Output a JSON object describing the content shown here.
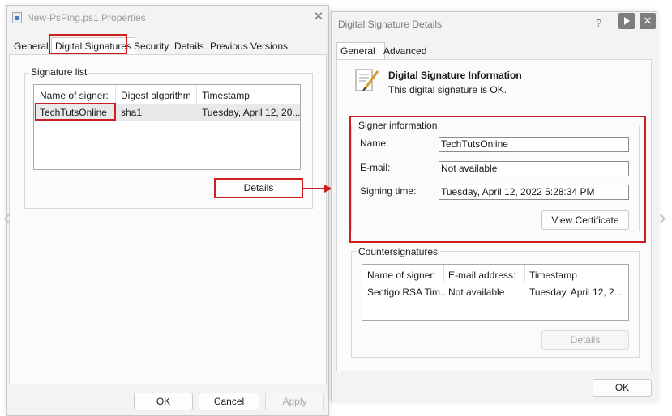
{
  "properties_window": {
    "title": "New-PsPing.ps1 Properties",
    "close_glyph": "✕",
    "tabs": [
      "General",
      "Digital Signatures",
      "Security",
      "Details",
      "Previous Versions"
    ],
    "active_tab": "Digital Signatures",
    "signature_list": {
      "label": "Signature list",
      "columns": [
        "Name of signer:",
        "Digest algorithm",
        "Timestamp"
      ],
      "rows": [
        {
          "signer": "TechTutsOnline",
          "digest": "sha1",
          "timestamp": "Tuesday, April 12, 20..."
        }
      ]
    },
    "details_button": "Details",
    "footer_buttons": {
      "ok": "OK",
      "cancel": "Cancel",
      "apply": "Apply"
    }
  },
  "details_window": {
    "title": "Digital Signature Details",
    "help_glyph": "?",
    "close_glyph": "✕",
    "tabs": [
      "General",
      "Advanced"
    ],
    "active_tab": "General",
    "info_heading": "Digital Signature Information",
    "info_status": "This digital signature is OK.",
    "signer_info": {
      "label": "Signer information",
      "name_label": "Name:",
      "name_value": "TechTutsOnline",
      "email_label": "E-mail:",
      "email_value": "Not available",
      "signing_time_label": "Signing time:",
      "signing_time_value": "Tuesday, April 12, 2022 5:28:34 PM",
      "view_certificate_button": "View Certificate"
    },
    "countersignatures": {
      "label": "Countersignatures",
      "columns": [
        "Name of signer:",
        "E-mail address:",
        "Timestamp"
      ],
      "rows": [
        {
          "signer": "Sectigo RSA Tim...",
          "email": "Not available",
          "timestamp": "Tuesday, April 12, 2..."
        }
      ],
      "details_button": "Details"
    },
    "ok_button": "OK"
  },
  "nav": {
    "prev_glyph": "‹",
    "next_glyph": "›"
  },
  "colors": {
    "highlight_red": "#cc1f1f",
    "window_bg": "#f3f3f3",
    "panel_bg": "#fbfbfb"
  }
}
